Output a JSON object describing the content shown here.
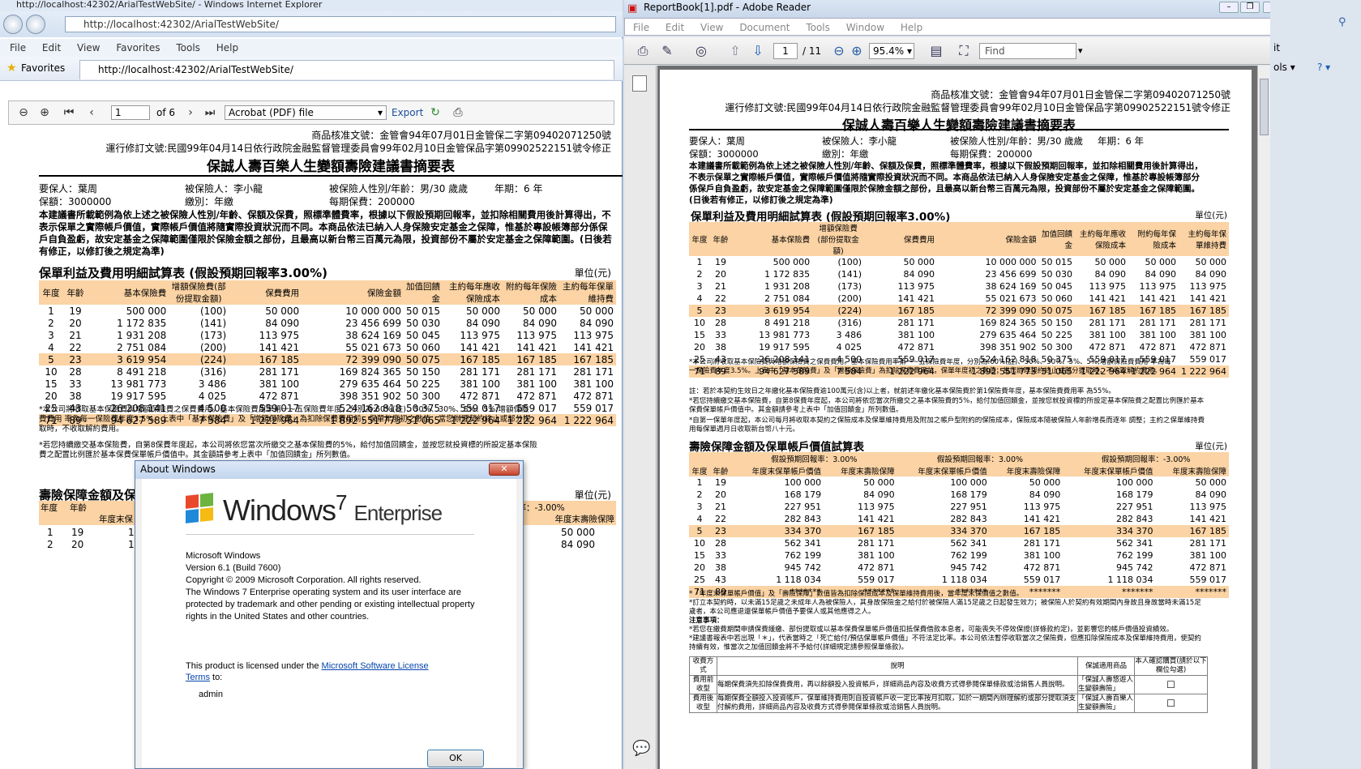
{
  "ie": {
    "title": "http://localhost:42302/ArialTestWebSite/ - Windows Internet Explorer",
    "address": "http://localhost:42302/ArialTestWebSite/",
    "menu": [
      "File",
      "Edit",
      "View",
      "Favorites",
      "Tools",
      "Help"
    ],
    "favorites_label": "Favorites",
    "tab_title": "http://localhost:42302/ArialTestWebSite/",
    "viewer": {
      "page_value": "1",
      "of_pages": "of 6",
      "format": "Acrobat (PDF) file",
      "export_label": "Export"
    }
  },
  "report": {
    "header1": "商品核准文號：金管會94年07月01日金管保二字第09402071250號",
    "header2": "運行修訂文號:民國99年04月14日依行政院金融監督管理委員會99年02月10日金管保品字第09902522151號令修正",
    "title": "保誠人壽百樂人生變額壽險建議書摘要表",
    "insured_label": "要保人：葉周",
    "insured2": "被保險人：李小龍",
    "gender_age": "被保險人性別/年齡：男/30 歲歲",
    "years": "年期：6 年",
    "amount": "保額：3000000",
    "pay": "繳別：年繳",
    "premium": "每期保費：200000",
    "note": "本建議書所載範例為依上述之被保險人性別/年齡、保額及保費，照標準體費率，根據以下假設預期回報率，並扣除相關費用後計算得出，不表示保單之實際帳戶價值，實際帳戶價值將隨實際投資狀況而不同。本商品依法已納入人身保險安定基金之保障，惟基於專設帳簿部分係保戶自負盈虧，故安定基金之保障範圍僅限於保險金額之部份，且最高以新台幣三百萬元為限，投資部份不屬於安定基金之保障範圍。(日後若有修正，以修訂後之規定為準)",
    "section1": "保單利益及費用明細試算表 (假設預期回報率3.00%)",
    "unit": "單位(元)",
    "table1_headers": [
      "年度",
      "年齡",
      "基本保險費",
      "增額保險費(部份提取金額)",
      "保費費用",
      "保險金額",
      "加值回饋金",
      "主約每年應收保險成本",
      "附約每年保險成本",
      "主約每年保單維持費"
    ],
    "table1": [
      [
        "1",
        "19",
        "500 000",
        "(100)",
        "50 000",
        "10 000 000",
        "50 015",
        "50 000",
        "50 000",
        "50 000"
      ],
      [
        "2",
        "20",
        "1 172 835",
        "(141)",
        "84 090",
        "23 456 699",
        "50 030",
        "84 090",
        "84 090",
        "84 090"
      ],
      [
        "3",
        "21",
        "1 931 208",
        "(173)",
        "113 975",
        "38 624 169",
        "50 045",
        "113 975",
        "113 975",
        "113 975"
      ],
      [
        "4",
        "22",
        "2 751 084",
        "(200)",
        "141 421",
        "55 021 673",
        "50 060",
        "141 421",
        "141 421",
        "141 421"
      ],
      [
        "5",
        "23",
        "3 619 954",
        "(224)",
        "167 185",
        "72 399 090",
        "50 075",
        "167 185",
        "167 185",
        "167 185"
      ],
      [
        "10",
        "28",
        "8 491 218",
        "(316)",
        "281 171",
        "169 824 365",
        "50 150",
        "281 171",
        "281 171",
        "281 171"
      ],
      [
        "15",
        "33",
        "13 981 773",
        "3 486",
        "381 100",
        "279 635 464",
        "50 225",
        "381 100",
        "381 100",
        "381 100"
      ],
      [
        "20",
        "38",
        "19 917 595",
        "4 025",
        "472 871",
        "398 351 902",
        "50 300",
        "472 871",
        "472 871",
        "472 871"
      ],
      [
        "25",
        "43",
        "26 208 141",
        "4 500",
        "559 017",
        "524 162 818",
        "50 375",
        "559 017",
        "559 017",
        "559 017"
      ],
      [
        "71",
        "89",
        "94 627 589",
        "7 584",
        "1 222 964",
        "1 892 551 773",
        "51 065",
        "1 222 964",
        "1 222 964",
        "1 222 964"
      ]
    ],
    "footnote1": "*本公司將收取基本保險費與增額保險費之保費費用。基本保險費用率第一~五保險費年度，分別為:60%(註)、50%、30%、5%、5%;增額保險費費用 率為每一保險費年度3.5%。上表中「基本保險費」及「增額保險費」為扣除保費費用前，保單年度初之數值；當您辦理契約終止或部分提取時，不收取解約費用。",
    "footnote2": "註：若於本契約生效日之年繳化基本保險費逾100萬元(含)以上者，就前述年繳化基本保險費於第1保險費年度，基本保險費費用率 為55%。",
    "footnote3": "*若您持續繳交基本保險費，自第8保費年度起，本公司將依您當次所繳交之基本保險費的5%，給付加值回饋金，並按您就投資標的所設定基本保險費之配置比例匯於基本保費保單帳戶價值中。其金額請參考上表中「加值回饋金」所列數值。",
    "footnote4": "*自第一保單年度起，本公司每月將收取本契約之保險成本及保單維持費用及附加之帳戶型附約的保險成本，保險成本隨被保險人年齡增長而逐年 調整；主約之保單維持費用每保單週月日收取新台幣八十元。",
    "section2": "壽險保障金額及保單帳戶價值試算表",
    "table2_rate_headers": [
      "假設預期回報率：3.00%",
      "假設預期回報率：3.00%",
      "假設預期回報率：-3.00%"
    ],
    "table2_headers": [
      "年度",
      "年齡",
      "年度末保單帳戶價值",
      "年度末壽險保障",
      "年度末保單帳戶價值",
      "年度末壽險保障",
      "年度末保單帳戶價值",
      "年度末壽險保障"
    ],
    "table2": [
      [
        "1",
        "19",
        "100 000",
        "50 000",
        "100 000",
        "50 000",
        "100 000",
        "50 000"
      ],
      [
        "2",
        "20",
        "168 179",
        "84 090",
        "168 179",
        "84 090",
        "168 179",
        "84 090"
      ],
      [
        "3",
        "21",
        "227 951",
        "113 975",
        "227 951",
        "113 975",
        "227 951",
        "113 975"
      ],
      [
        "4",
        "22",
        "282 843",
        "141 421",
        "282 843",
        "141 421",
        "282 843",
        "141 421"
      ],
      [
        "5",
        "23",
        "334 370",
        "167 185",
        "334 370",
        "167 185",
        "334 370",
        "167 185"
      ],
      [
        "10",
        "28",
        "562 341",
        "281 171",
        "562 341",
        "281 171",
        "562 341",
        "281 171"
      ],
      [
        "15",
        "33",
        "762 199",
        "381 100",
        "762 199",
        "381 100",
        "762 199",
        "381 100"
      ],
      [
        "20",
        "38",
        "945 742",
        "472 871",
        "945 742",
        "472 871",
        "945 742",
        "472 871"
      ],
      [
        "25",
        "43",
        "1 118 034",
        "559 017",
        "1 118 034",
        "559 017",
        "1 118 034",
        "559 017"
      ],
      [
        "71",
        "89",
        "*******",
        "*******",
        "*******",
        "*******",
        "*******",
        "*******"
      ]
    ],
    "ie_rate_right": "報率：-3.00%",
    "ie_t2_last_header": "年度末壽險保障",
    "ie_t2_partial_hdr": "年度末保",
    "ie_t2_rows": [
      [
        "1",
        "19",
        "100",
        "50 000"
      ],
      [
        "2",
        "20",
        "168",
        "84 090"
      ]
    ],
    "notes2": [
      "*「年度末保單帳戶價值」及「壽險保障」數值皆為扣除保險成本及保單維持費用後，當年度末保價值之數值。",
      "*訂立本契約時，以未滿15足歲之未成年人為被保險人，其身故保險金之給付於被保險人滿15足歲之日起發生效力；被保險人於契約有效期間內身故且身故當時未滿15足歲者，本公司應退還保單帳戶價值予要保人或其他應得之人。",
      "注意事項：",
      "*若您在繳費期間申請保費緩繳、部份提取或以基本保費保單帳戶價值扣抵保費借款本息者，可能喪失不停效保證(詳條款約定)，並影響您的帳戶價值投資績效。",
      "*建議書報表中若出現「＊」，代表當時之「死亡給付/預估保單帳戶價值」不符法定比率。本公司依法暫停收取當次之保險費，但應扣除保險成本及保單維持費用，使契約持續有效，惟當次之加值回饋金將不予給付(詳細規定請參照保單條款)。"
    ],
    "fee_table_headers": [
      "收費方式",
      "說明",
      "保誠適用商品",
      "本人確認購買(請於以下欄位勾選)"
    ],
    "fee_rows": [
      [
        "費用前收型",
        "每期保費須先扣除保費費用，再以餘額投入投資帳戶，詳細商品內容及收費方式得參閱保單條款或洽銷售人員說明。",
        "「保誠人壽悠遊人生變額壽險」",
        "☐"
      ],
      [
        "費用後收型",
        "每期保費全額投入投資帳戶，保單維持費用則自投資帳戶收一定比率按月扣取，如於一期間內辦理解約或部分提取須支付解約費用，詳細商品內容及收費方式得參閱保單條款或洽銷售人員說明。",
        "「保誠人壽百樂人生變額壽險」",
        "☐"
      ]
    ]
  },
  "about": {
    "caption": "About Windows",
    "close": "✕",
    "logo_main": "Windows",
    "logo_ver": "7",
    "logo_ed": "Enterprise",
    "l1": "Microsoft Windows",
    "l2": "Version 6.1 (Build 7600)",
    "l3": "Copyright © 2009 Microsoft Corporation.  All rights reserved.",
    "l4": "The Windows 7 Enterprise operating system and its user interface are protected by trademark and other pending or existing intellectual property rights in the United States and other countries.",
    "l5a": "This product is licensed under the ",
    "l5link": "Microsoft Software License Terms",
    "l5b": " to:",
    "user": "admin",
    "ok": "OK"
  },
  "adobe": {
    "title": "ReportBook[1].pdf - Adobe Reader",
    "menu": [
      "File",
      "Edit",
      "View",
      "Document",
      "Tools",
      "Window",
      "Help"
    ],
    "page_value": "1",
    "page_total": "/ 11",
    "zoom": "95.4%",
    "find": "Find",
    "close": "×"
  },
  "right_strip": {
    "it": "it",
    "ols": "ols ▾",
    "help": "? ▾"
  }
}
